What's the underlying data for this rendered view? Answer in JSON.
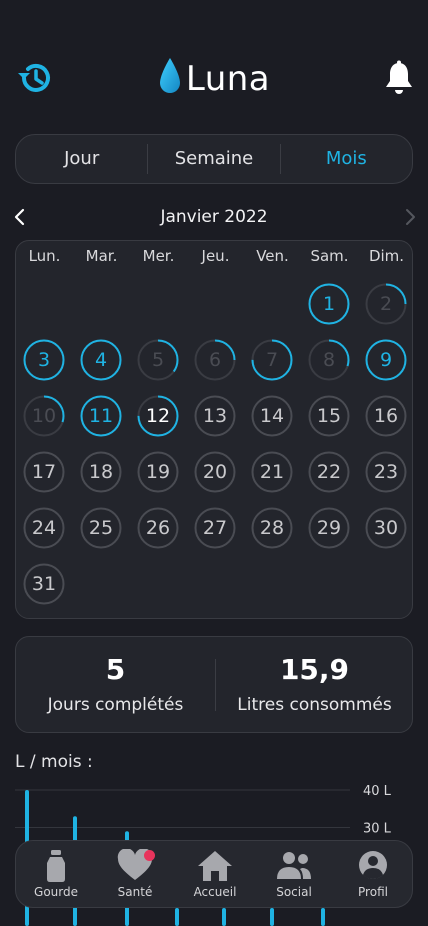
{
  "app": {
    "name": "Luna"
  },
  "header": {
    "history_icon": "history-icon",
    "bell_icon": "bell-icon"
  },
  "tabs": [
    {
      "label": "Jour",
      "active": false
    },
    {
      "label": "Semaine",
      "active": false
    },
    {
      "label": "Mois",
      "active": true
    }
  ],
  "calendar": {
    "month_label": "Janvier 2022",
    "weekdays": [
      "Lun.",
      "Mar.",
      "Mer.",
      "Jeu.",
      "Ven.",
      "Sam.",
      "Dim."
    ],
    "first_weekday_index": 5,
    "days": [
      {
        "day": "1",
        "progress": 1.0
      },
      {
        "day": "2",
        "progress": 0.25
      },
      {
        "day": "3",
        "progress": 1.0
      },
      {
        "day": "4",
        "progress": 1.0
      },
      {
        "day": "5",
        "progress": 0.35
      },
      {
        "day": "6",
        "progress": 0.25
      },
      {
        "day": "7",
        "progress": 0.75
      },
      {
        "day": "8",
        "progress": 0.3
      },
      {
        "day": "9",
        "progress": 1.0
      },
      {
        "day": "10",
        "progress": 0.3
      },
      {
        "day": "11",
        "progress": 1.0
      },
      {
        "day": "12",
        "progress": 0.75,
        "today": true
      },
      {
        "day": "13"
      },
      {
        "day": "14"
      },
      {
        "day": "15"
      },
      {
        "day": "16"
      },
      {
        "day": "17"
      },
      {
        "day": "18"
      },
      {
        "day": "19"
      },
      {
        "day": "20"
      },
      {
        "day": "21"
      },
      {
        "day": "22"
      },
      {
        "day": "23"
      },
      {
        "day": "24"
      },
      {
        "day": "25"
      },
      {
        "day": "26"
      },
      {
        "day": "27"
      },
      {
        "day": "28"
      },
      {
        "day": "29"
      },
      {
        "day": "30"
      },
      {
        "day": "31"
      }
    ]
  },
  "stats": {
    "completed_days": {
      "value": "5",
      "label": "Jours complétés"
    },
    "liters": {
      "value": "15,9",
      "label": "Litres consommés"
    }
  },
  "chart_data": {
    "type": "bar",
    "title": "L / mois :",
    "ylabel": "L",
    "y_tick_labels": [
      "40 L",
      "30 L"
    ],
    "y_ticks": [
      40,
      30
    ],
    "values": [
      40,
      33,
      29
    ]
  },
  "bottom_nav": [
    {
      "label": "Gourde",
      "icon": "bottle-icon"
    },
    {
      "label": "Santé",
      "icon": "heart-icon",
      "badge": true
    },
    {
      "label": "Accueil",
      "icon": "home-icon"
    },
    {
      "label": "Social",
      "icon": "people-icon"
    },
    {
      "label": "Profil",
      "icon": "profile-icon"
    }
  ],
  "colors": {
    "background": "#1b1c23",
    "card": "#23252c",
    "accent": "#1fb3e3",
    "muted_ring": "#4a4c53",
    "badge": "#e8345c"
  }
}
